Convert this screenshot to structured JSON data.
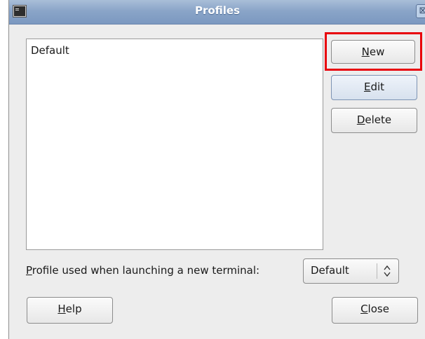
{
  "window": {
    "title": "Profiles",
    "icon": "terminal-icon",
    "close_glyph": "⊠"
  },
  "profiles": {
    "items": [
      {
        "label": "Default"
      }
    ]
  },
  "buttons": {
    "new": {
      "mnemonic": "N",
      "rest": "ew"
    },
    "edit": {
      "mnemonic": "E",
      "rest": "dit"
    },
    "delete": {
      "mnemonic": "D",
      "rest": "elete"
    },
    "help": {
      "mnemonic": "H",
      "rest": "elp"
    },
    "close": {
      "mnemonic": "C",
      "rest": "lose"
    }
  },
  "launch_label": {
    "mnemonic": "P",
    "rest": "rofile used when launching a new terminal:"
  },
  "profile_select": {
    "value": "Default",
    "arrows_icon": "up-down-arrows-icon"
  },
  "colors": {
    "titlebar": "#8aa5c8",
    "highlight": "#e8000b",
    "dialog_bg": "#ededed"
  }
}
